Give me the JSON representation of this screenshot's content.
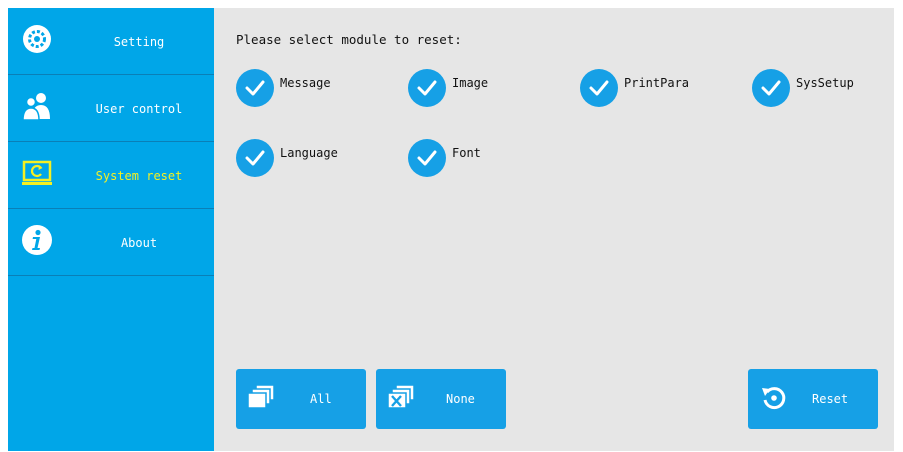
{
  "sidebar": {
    "items": [
      {
        "label": "Setting",
        "icon": "gear-icon"
      },
      {
        "label": "User control",
        "icon": "users-icon"
      },
      {
        "label": "System reset",
        "icon": "system-reset-icon",
        "active": true
      },
      {
        "label": "About",
        "icon": "info-icon"
      }
    ]
  },
  "main": {
    "prompt": "Please select module to reset:",
    "modules": [
      {
        "label": "Message",
        "checked": true
      },
      {
        "label": "Image",
        "checked": true
      },
      {
        "label": "PrintPara",
        "checked": true
      },
      {
        "label": "SysSetup",
        "checked": true
      },
      {
        "label": "Language",
        "checked": true
      },
      {
        "label": "Font",
        "checked": true
      }
    ]
  },
  "buttons": {
    "all_label": "All",
    "none_label": "None",
    "reset_label": "Reset"
  },
  "colors": {
    "accent": "#00a6e8",
    "active_text": "#f4f023",
    "background": "#e6e6e6"
  }
}
